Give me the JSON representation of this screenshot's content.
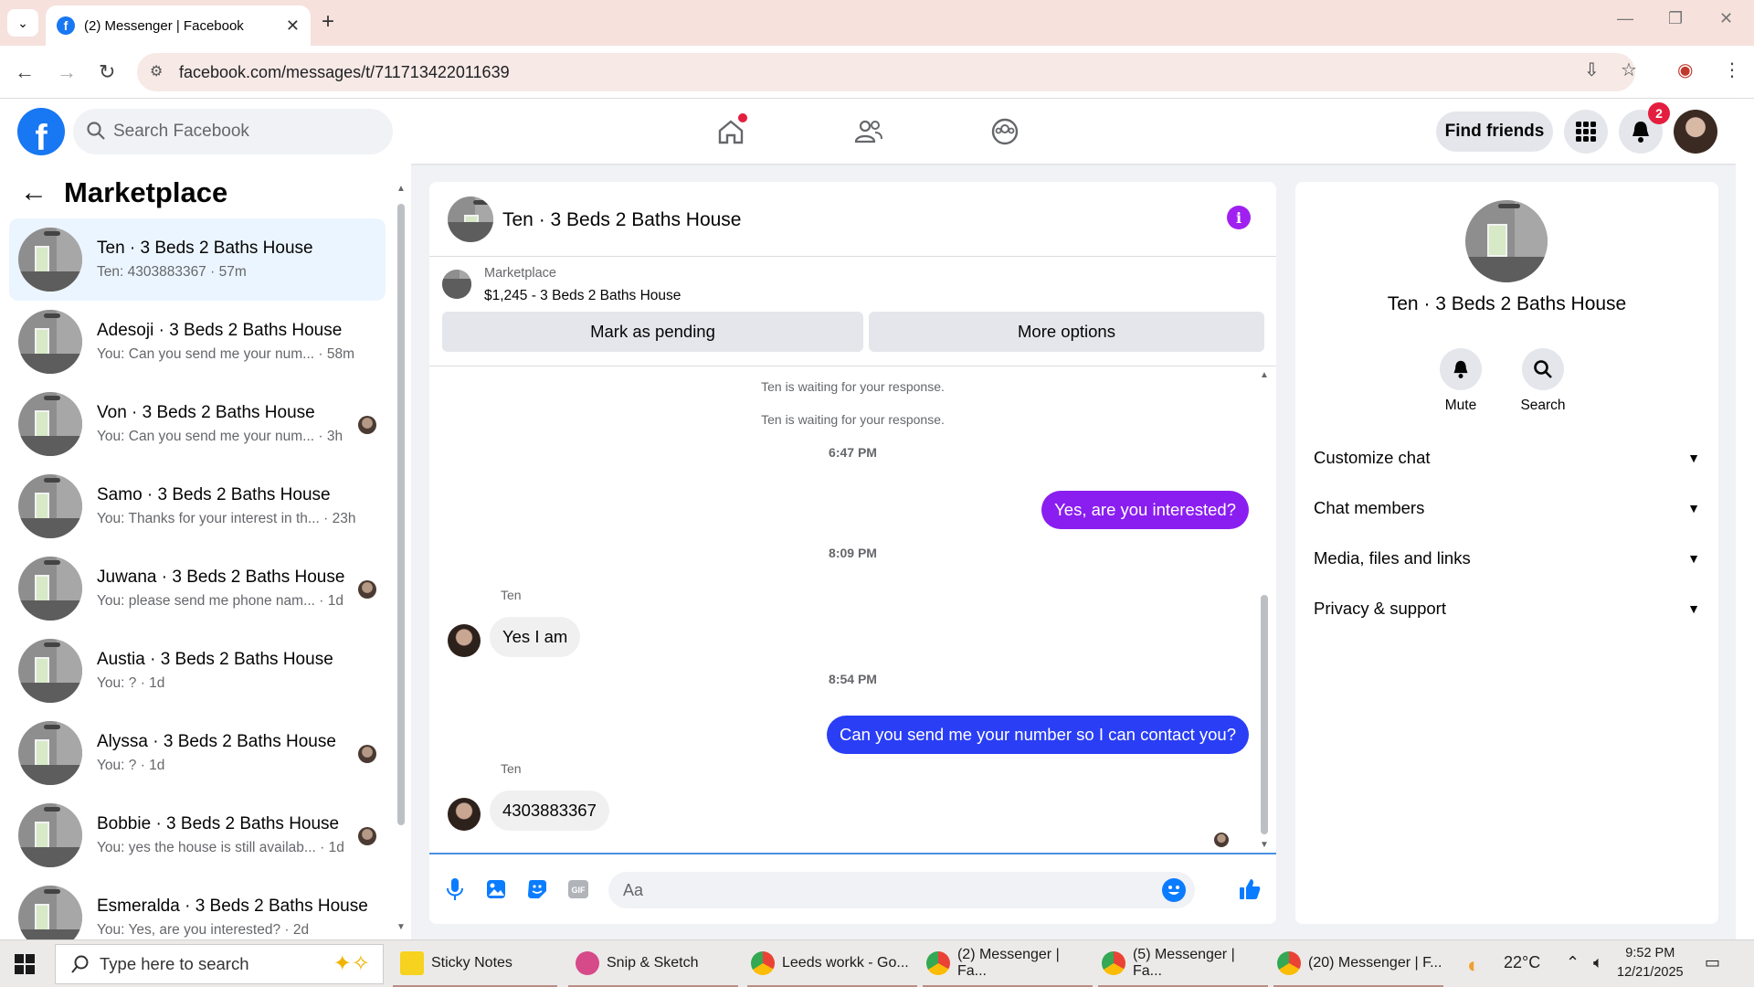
{
  "browser": {
    "tab_title": "(2) Messenger | Facebook",
    "url": "facebook.com/messages/t/711713422011639",
    "favicon_letter": "f"
  },
  "header": {
    "search_placeholder": "Search Facebook",
    "find_friends": "Find friends",
    "notification_count": "2"
  },
  "sidebar": {
    "title": "Marketplace",
    "conversations": [
      {
        "name": "Ten · 3 Beds 2 Baths House",
        "preview": "Ten: 4303883367 · 57m",
        "active": true
      },
      {
        "name": "Adesoji · 3 Beds 2 Baths House",
        "preview": "You: Can you send me your num... · 58m"
      },
      {
        "name": "Von · 3 Beds 2 Baths House",
        "preview": "You: Can you send me your num... · 3h"
      },
      {
        "name": "Samo · 3 Beds 2 Baths House",
        "preview": "You: Thanks for your interest in th... · 23h"
      },
      {
        "name": "Juwana · 3 Beds 2 Baths House",
        "preview": "You: please send me phone nam... · 1d"
      },
      {
        "name": "Austia · 3 Beds 2 Baths House",
        "preview": "You: ? · 1d"
      },
      {
        "name": "Alyssa · 3 Beds 2 Baths House",
        "preview": "You: ? · 1d"
      },
      {
        "name": "Bobbie · 3 Beds 2 Baths House",
        "preview": "You: yes the house is still availab... · 1d"
      },
      {
        "name": "Esmeralda · 3 Beds 2 Baths House",
        "preview": "You: Yes, are you interested? · 2d"
      }
    ]
  },
  "chat": {
    "title": "Ten · 3 Beds 2 Baths House",
    "listing_label": "Marketplace",
    "listing_detail": "$1,245 - 3 Beds 2 Baths House",
    "mark_pending": "Mark as pending",
    "more_options": "More options",
    "system_1": "Ten is waiting for your response.",
    "system_2": "Ten is waiting for your response.",
    "time_1": "6:47 PM",
    "out_1": "Yes, are you interested?",
    "time_2": "8:09 PM",
    "sender_1": "Ten",
    "in_1": "Yes I am",
    "time_3": "8:54 PM",
    "out_2": "Can you send me your number so I can contact you?",
    "sender_2": "Ten",
    "in_2": "4303883367",
    "composer_placeholder": "Aa",
    "colors": {
      "out_bubble_1": "#8a1ef0",
      "out_bubble_2": "#2a3ef5",
      "accent": "#0a7cff"
    }
  },
  "details": {
    "name": "Ten · 3 Beds 2 Baths House",
    "mute": "Mute",
    "search": "Search",
    "rows": [
      "Customize chat",
      "Chat members",
      "Media, files and links",
      "Privacy & support"
    ]
  },
  "taskbar": {
    "search_placeholder": "Type here to search",
    "apps": [
      "Sticky Notes",
      "Snip & Sketch",
      "Leeds workk - Go...",
      "(2) Messenger | Fa...",
      "(5) Messenger | Fa...",
      "(20) Messenger | F..."
    ],
    "temperature": "22°C",
    "time": "9:52 PM",
    "date": "12/21/2025"
  }
}
